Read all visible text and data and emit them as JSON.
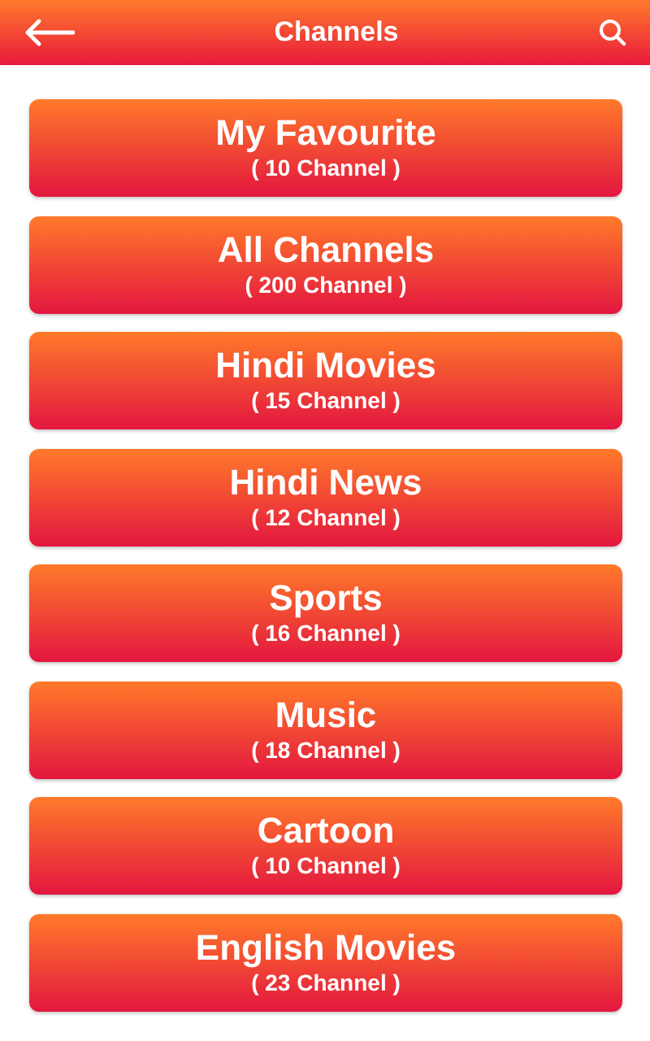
{
  "header": {
    "title": "Channels"
  },
  "categories": [
    {
      "name": "My Favourite",
      "count": "( 10 Channel )"
    },
    {
      "name": "All Channels",
      "count": "( 200 Channel )"
    },
    {
      "name": "Hindi Movies",
      "count": "( 15 Channel )"
    },
    {
      "name": "Hindi News",
      "count": "( 12 Channel )"
    },
    {
      "name": "Sports",
      "count": "( 16 Channel )"
    },
    {
      "name": "Music",
      "count": "( 18 Channel )"
    },
    {
      "name": "Cartoon",
      "count": "( 10 Channel )"
    },
    {
      "name": "English Movies",
      "count": "( 23 Channel )"
    }
  ]
}
